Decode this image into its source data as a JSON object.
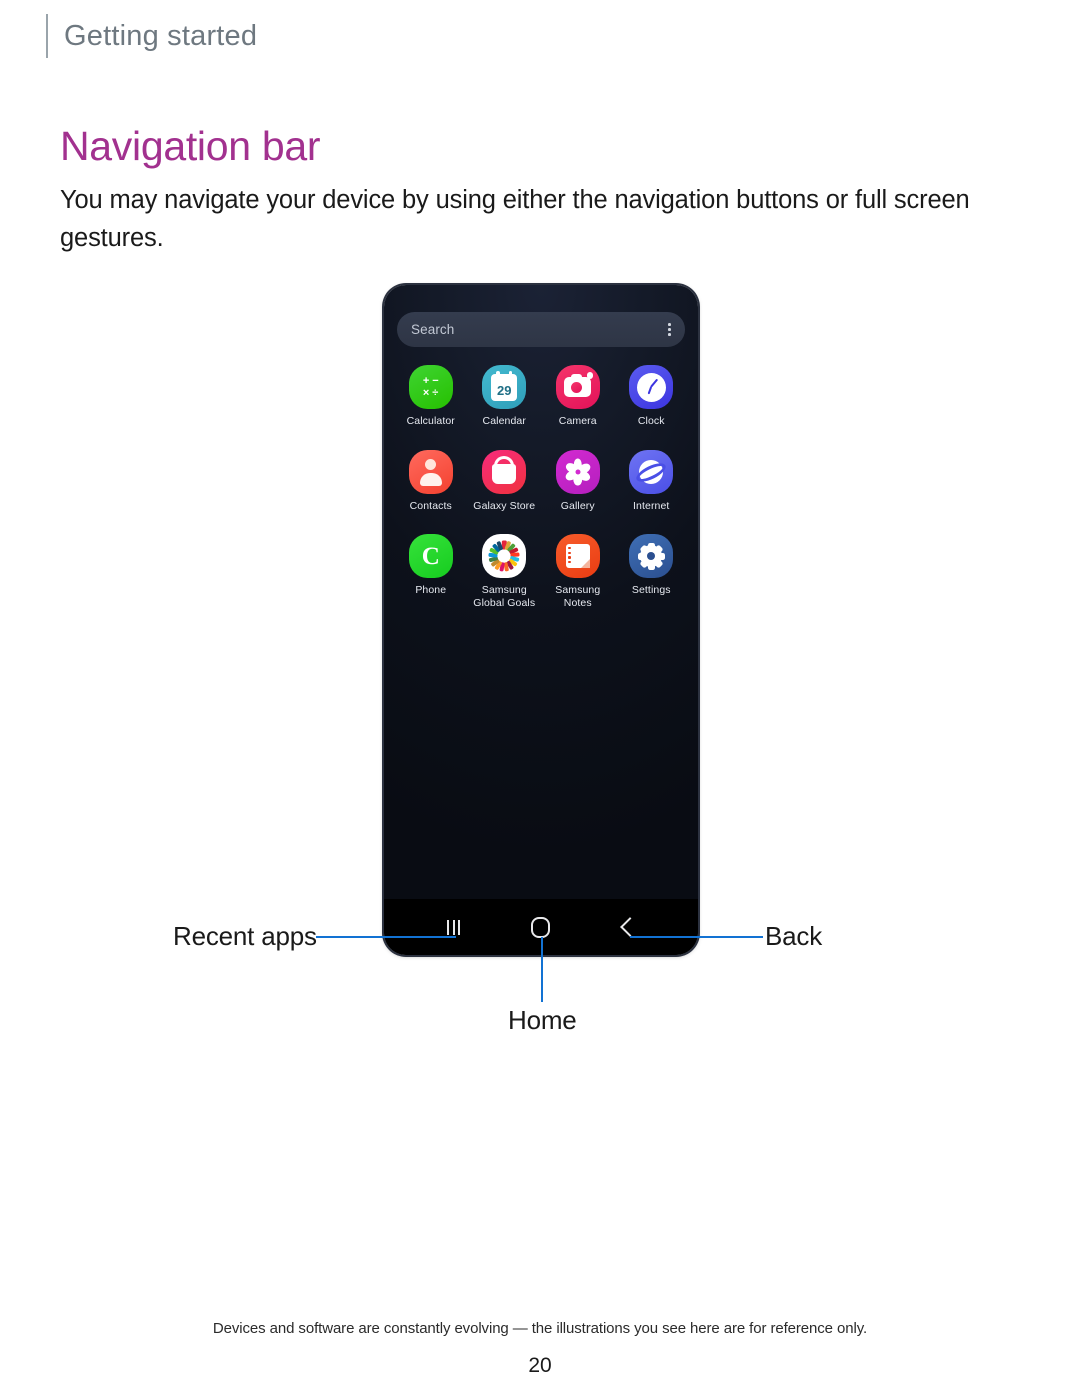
{
  "header": {
    "section": "Getting started"
  },
  "title": "Navigation bar",
  "body": "You may navigate your device by using either the navigation buttons or full screen gestures.",
  "phone": {
    "search": {
      "placeholder": "Search",
      "menu_icon": "kebab-menu-icon"
    },
    "apps": [
      {
        "label": "Calculator",
        "icon": "calculator-icon",
        "color": "#2ec81d"
      },
      {
        "label": "Calendar",
        "icon": "calendar-icon",
        "color": "#37a9c4",
        "badge": "29"
      },
      {
        "label": "Camera",
        "icon": "camera-icon",
        "color": "#ec1b5f"
      },
      {
        "label": "Clock",
        "icon": "clock-icon",
        "color": "#4640e6"
      },
      {
        "label": "Contacts",
        "icon": "contacts-icon",
        "color": "#f74f3c"
      },
      {
        "label": "Galaxy Store",
        "icon": "galaxy-store-icon",
        "color": "#f42f63"
      },
      {
        "label": "Gallery",
        "icon": "gallery-icon",
        "color": "#c824c8"
      },
      {
        "label": "Internet",
        "icon": "internet-icon",
        "color": "#555aea"
      },
      {
        "label": "Phone",
        "icon": "phone-icon",
        "color": "#22d229"
      },
      {
        "label": "Samsung\nGlobal Goals",
        "icon": "global-goals-icon",
        "color": "#ffffff"
      },
      {
        "label": "Samsung\nNotes",
        "icon": "samsung-notes-icon",
        "color": "#ef4518"
      },
      {
        "label": "Settings",
        "icon": "settings-gear-icon",
        "color": "#325ba2"
      }
    ],
    "navigation": {
      "recents_icon": "recent-apps-icon",
      "home_icon": "home-icon",
      "back_icon": "back-chevron-icon"
    }
  },
  "callouts": {
    "recent_apps": "Recent apps",
    "home": "Home",
    "back": "Back",
    "leader_color": "#1272d3"
  },
  "footer": {
    "disclaimer": "Devices and software are constantly evolving — the illustrations you see here are for reference only.",
    "page_number": "20"
  }
}
